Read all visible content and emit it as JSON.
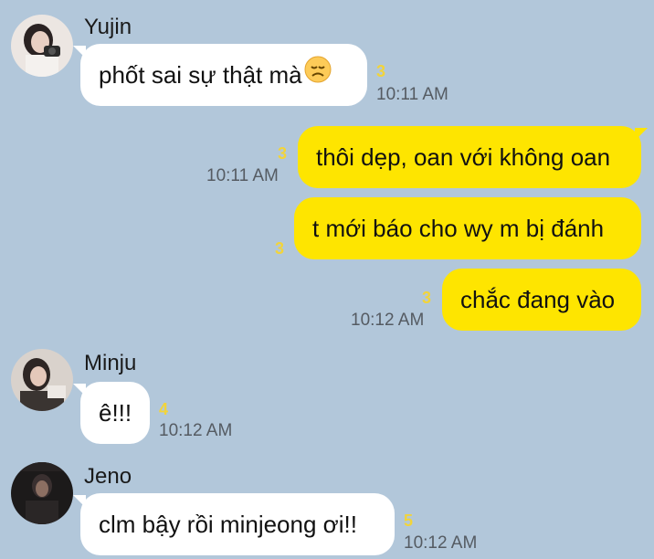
{
  "colors": {
    "background": "#B2C7DA",
    "incoming_bubble": "#FFFFFF",
    "outgoing_bubble": "#FEE500",
    "unread_count": "#F2D43A",
    "timestamp": "#555B62"
  },
  "messages": [
    {
      "sender": "Yujin",
      "avatar": "yujin-avatar",
      "text": "phốt sai sự thật mà",
      "emoji": "disappointed-face-icon",
      "unread": "3",
      "time": "10:11 AM",
      "direction": "incoming"
    },
    {
      "text": "thôi dẹp, oan với không oan",
      "unread": "3",
      "time": "10:11 AM",
      "direction": "outgoing"
    },
    {
      "text": "t mới báo cho wy m bị đánh",
      "unread": "3",
      "direction": "outgoing"
    },
    {
      "text": "chắc đang vào",
      "unread": "3",
      "time": "10:12 AM",
      "direction": "outgoing"
    },
    {
      "sender": "Minju",
      "avatar": "minju-avatar",
      "text": "ê!!!",
      "unread": "4",
      "time": "10:12 AM",
      "direction": "incoming"
    },
    {
      "sender": "Jeno",
      "avatar": "jeno-avatar",
      "text": "clm bậy rồi minjeong ơi!!",
      "unread": "5",
      "time": "10:12 AM",
      "direction": "incoming"
    }
  ]
}
